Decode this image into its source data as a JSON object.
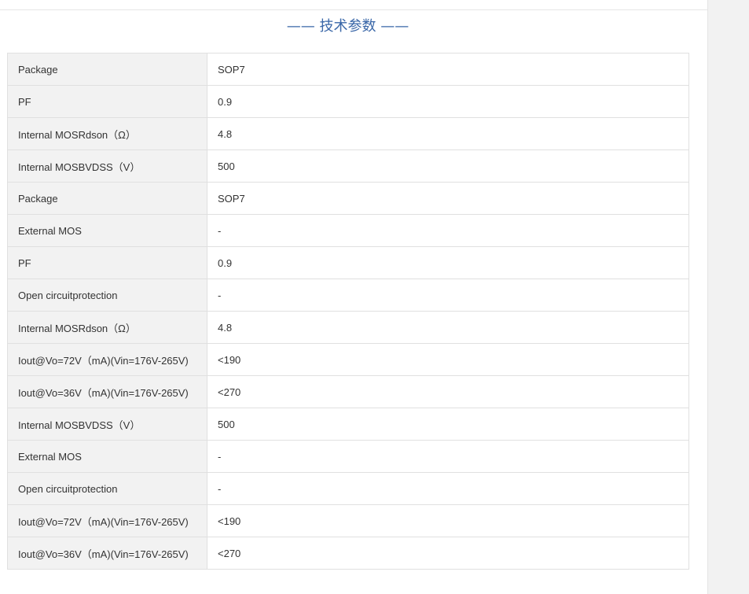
{
  "section": {
    "title": "—— 技术参数 ——"
  },
  "specs": [
    {
      "param": "Package",
      "value": "SOP7"
    },
    {
      "param": "PF",
      "value": "0.9"
    },
    {
      "param": "Internal MOSRdson（Ω）",
      "value": "4.8"
    },
    {
      "param": "Internal MOSBVDSS（V）",
      "value": "500"
    },
    {
      "param": "Package",
      "value": "SOP7"
    },
    {
      "param": "External MOS",
      "value": "-"
    },
    {
      "param": "PF",
      "value": "0.9"
    },
    {
      "param": "Open circuitprotection",
      "value": "-"
    },
    {
      "param": "Internal MOSRdson（Ω）",
      "value": "4.8"
    },
    {
      "param": "Iout@Vo=72V（mA)(Vin=176V-265V)",
      "value": "<190"
    },
    {
      "param": "Iout@Vo=36V（mA)(Vin=176V-265V)",
      "value": "<270"
    },
    {
      "param": "Internal MOSBVDSS（V）",
      "value": "500"
    },
    {
      "param": "External MOS",
      "value": "-"
    },
    {
      "param": "Open circuitprotection",
      "value": "-"
    },
    {
      "param": "Iout@Vo=72V（mA)(Vin=176V-265V)",
      "value": "<190"
    },
    {
      "param": "Iout@Vo=36V（mA)(Vin=176V-265V)",
      "value": "<270"
    }
  ]
}
